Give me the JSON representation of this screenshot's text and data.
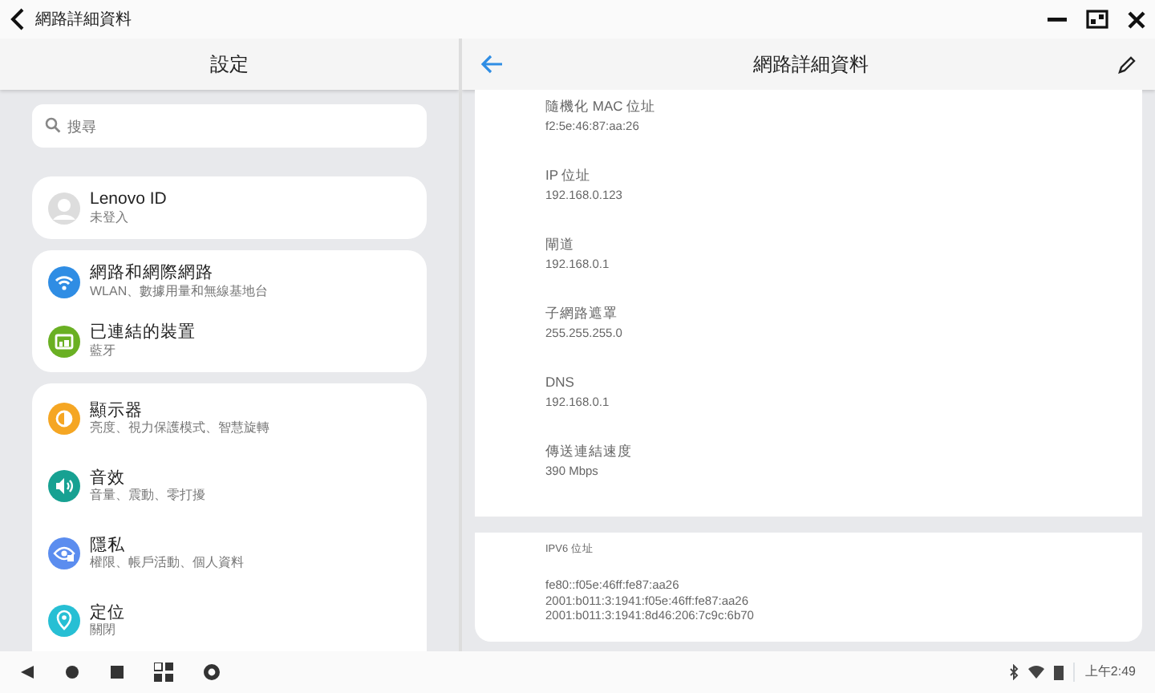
{
  "window": {
    "title": "網路詳細資料"
  },
  "settings": {
    "title": "設定",
    "search": {
      "placeholder": "搜尋"
    },
    "account": {
      "name": "Lenovo ID",
      "status": "未登入"
    },
    "groups": [
      [
        {
          "title": "網路和網際網路",
          "subtitle": "WLAN、數據用量和無線基地台",
          "color": "#2f8de4"
        },
        {
          "title": "已連結的裝置",
          "subtitle": "藍牙",
          "color": "#6ab023"
        }
      ],
      [
        {
          "title": "顯示器",
          "subtitle": "亮度、視力保護模式、智慧旋轉",
          "color": "#f5a623"
        },
        {
          "title": "音效",
          "subtitle": "音量、震動、零打擾",
          "color": "#17a192"
        },
        {
          "title": "隱私",
          "subtitle": "權限、帳戶活動、個人資料",
          "color": "#5b8def"
        },
        {
          "title": "定位",
          "subtitle": "關閉",
          "color": "#27bfd4"
        }
      ]
    ]
  },
  "details": {
    "title": "網路詳細資料",
    "fields": [
      {
        "label": "隨機化 MAC 位址",
        "value": "f2:5e:46:87:aa:26"
      },
      {
        "label": "IP 位址",
        "value": "192.168.0.123"
      },
      {
        "label": "閘道",
        "value": "192.168.0.1"
      },
      {
        "label": "子網路遮罩",
        "value": "255.255.255.0"
      },
      {
        "label": "DNS",
        "value": "192.168.0.1"
      },
      {
        "label": "傳送連結速度",
        "value": "390 Mbps"
      }
    ],
    "ipv6": {
      "label": "IPV6 位址",
      "values": [
        "fe80::f05e:46ff:fe87:aa26",
        "2001:b011:3:1941:f05e:46ff:fe87:aa26",
        "2001:b011:3:1941:8d46:206:7c9c:6b70"
      ]
    }
  },
  "taskbar": {
    "time": "上午2:49"
  }
}
